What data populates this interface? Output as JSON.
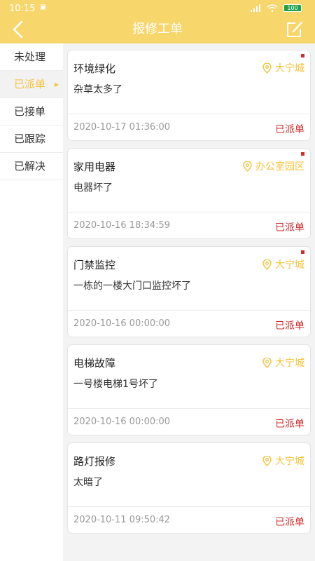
{
  "status_bar": {
    "time": "10:15",
    "battery": "100"
  },
  "header": {
    "title": "报修工单"
  },
  "sidebar": {
    "items": [
      {
        "label": "未处理",
        "active": false
      },
      {
        "label": "已派单",
        "active": true
      },
      {
        "label": "已接单",
        "active": false
      },
      {
        "label": "已跟踪",
        "active": false
      },
      {
        "label": "已解决",
        "active": false
      }
    ]
  },
  "orders": [
    {
      "title": "环境绿化",
      "location": "大宁城",
      "desc": "杂草太多了",
      "date": "2020-10-17 01:36:00",
      "status": "已派单",
      "unread": true
    },
    {
      "title": "家用电器",
      "location": "办公室园区",
      "desc": "电器坏了",
      "date": "2020-10-16 18:34:59",
      "status": "已派单",
      "unread": true
    },
    {
      "title": "门禁监控",
      "location": "大宁城",
      "desc": "一栋的一楼大门口监控坏了",
      "date": "2020-10-16 00:00:00",
      "status": "已派单",
      "unread": true
    },
    {
      "title": "电梯故障",
      "location": "大宁城",
      "desc": "一号楼电梯1号坏了",
      "date": "2020-10-16 00:00:00",
      "status": "已派单",
      "unread": false
    },
    {
      "title": "路灯报修",
      "location": "大宁城",
      "desc": "太暗了",
      "date": "2020-10-11 09:50:42",
      "status": "已派单",
      "unread": false
    }
  ],
  "colors": {
    "header_bg": "#f7d66b",
    "accent": "#f5c33b",
    "status_red": "#cc2b2b",
    "unread_dot": "#d62a2a"
  },
  "icons": {
    "back": "back-chevron-icon",
    "edit": "edit-icon",
    "location": "location-pin-icon"
  }
}
